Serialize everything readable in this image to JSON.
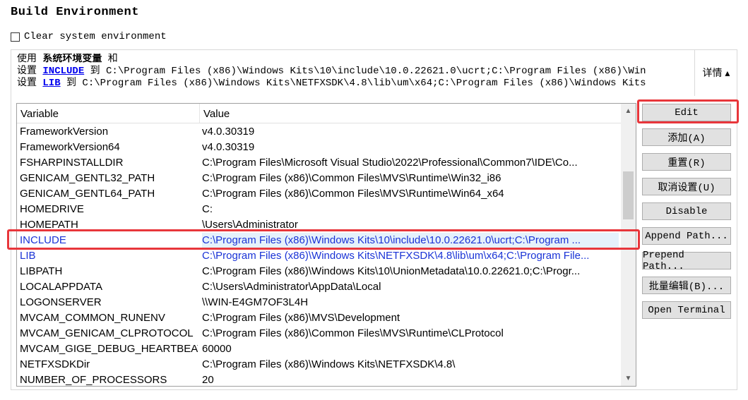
{
  "header": {
    "title": "Build Environment",
    "clear_label": "Clear system environment"
  },
  "info": {
    "line1_prefix": "使用 ",
    "line1_bold": "系统环境变量",
    "line1_suffix": " 和",
    "line2_prefix": "设置 ",
    "line2_link": "INCLUDE",
    "line2_rest": " 到 C:\\Program Files (x86)\\Windows Kits\\10\\include\\10.0.22621.0\\ucrt;C:\\Program Files (x86)\\Win",
    "line3_prefix": "设置 ",
    "line3_link": "LIB",
    "line3_rest": " 到 C:\\Program Files (x86)\\Windows Kits\\NETFXSDK\\4.8\\lib\\um\\x64;C:\\Program Files (x86)\\Windows Kits",
    "details_label": "详情 ▴"
  },
  "table": {
    "columns": [
      "Variable",
      "Value"
    ],
    "rows": [
      {
        "var": "FrameworkVersion",
        "val": "v4.0.30319"
      },
      {
        "var": "FrameworkVersion64",
        "val": "v4.0.30319"
      },
      {
        "var": "FSHARPINSTALLDIR",
        "val": "C:\\Program Files\\Microsoft Visual Studio\\2022\\Professional\\Common7\\IDE\\Co..."
      },
      {
        "var": "GENICAM_GENTL32_PATH",
        "val": "C:\\Program Files (x86)\\Common Files\\MVS\\Runtime\\Win32_i86"
      },
      {
        "var": "GENICAM_GENTL64_PATH",
        "val": "C:\\Program Files (x86)\\Common Files\\MVS\\Runtime\\Win64_x64"
      },
      {
        "var": "HOMEDRIVE",
        "val": "C:"
      },
      {
        "var": "HOMEPATH",
        "val": "\\Users\\Administrator"
      },
      {
        "var": "INCLUDE",
        "val": "C:\\Program Files (x86)\\Windows Kits\\10\\include\\10.0.22621.0\\ucrt;C:\\Program ..."
      },
      {
        "var": "LIB",
        "val": "C:\\Program Files (x86)\\Windows Kits\\NETFXSDK\\4.8\\lib\\um\\x64;C:\\Program File..."
      },
      {
        "var": "LIBPATH",
        "val": "C:\\Program Files (x86)\\Windows Kits\\10\\UnionMetadata\\10.0.22621.0;C:\\Progr..."
      },
      {
        "var": "LOCALAPPDATA",
        "val": "C:\\Users\\Administrator\\AppData\\Local"
      },
      {
        "var": "LOGONSERVER",
        "val": "\\\\WIN-E4GM7OF3L4H"
      },
      {
        "var": "MVCAM_COMMON_RUNENV",
        "val": "C:\\Program Files (x86)\\MVS\\Development"
      },
      {
        "var": "MVCAM_GENICAM_CLPROTOCOL",
        "val": "C:\\Program Files (x86)\\Common Files\\MVS\\Runtime\\CLProtocol"
      },
      {
        "var": "MVCAM_GIGE_DEBUG_HEARTBEAT",
        "val": "60000"
      },
      {
        "var": "NETFXSDKDir",
        "val": "C:\\Program Files (x86)\\Windows Kits\\NETFXSDK\\4.8\\"
      },
      {
        "var": "NUMBER_OF_PROCESSORS",
        "val": "20"
      }
    ]
  },
  "buttons": {
    "edit": "Edit",
    "add": "添加(A)",
    "reset": "重置(R)",
    "unset": "取消设置(U)",
    "disable": "Disable",
    "append": "Append Path...",
    "prepend": "Prepend Path...",
    "batch": "批量编辑(B)...",
    "terminal": "Open Terminal"
  },
  "colors": {
    "highlight": "#e8363b",
    "modified_text": "#1a33d6",
    "link": "#0000ee"
  }
}
